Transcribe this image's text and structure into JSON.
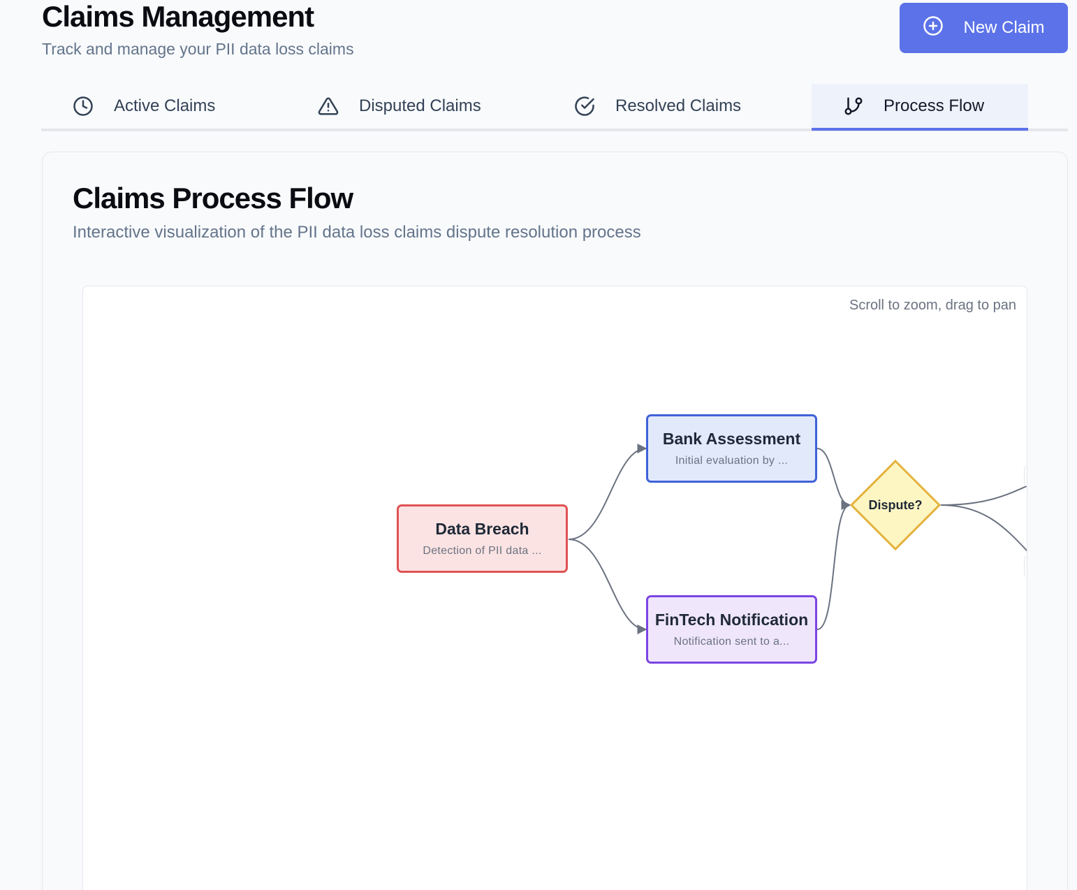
{
  "header": {
    "title": "Claims Management",
    "subtitle": "Track and manage your PII data loss claims",
    "new_claim_label": "New Claim"
  },
  "tabs": [
    {
      "label": "Active Claims",
      "icon": "clock-icon",
      "active": false
    },
    {
      "label": "Disputed Claims",
      "icon": "alert-triangle-icon",
      "active": false
    },
    {
      "label": "Resolved Claims",
      "icon": "check-circle-icon",
      "active": false
    },
    {
      "label": "Process Flow",
      "icon": "git-branch-icon",
      "active": true
    }
  ],
  "card": {
    "title": "Claims Process Flow",
    "subtitle": "Interactive visualization of the PII data loss claims dispute resolution process"
  },
  "flow": {
    "hint": "Scroll to zoom, drag to pan",
    "nodes": {
      "breach": {
        "title": "Data Breach",
        "desc": "Detection of PII data ..."
      },
      "bank": {
        "title": "Bank Assessment",
        "desc": "Initial evaluation by ..."
      },
      "fintech": {
        "title": "FinTech Notification",
        "desc": "Notification sent to a..."
      },
      "decision": {
        "label": "Dispute?"
      }
    }
  },
  "colors": {
    "accent": "#5b72e8",
    "breach_border": "#e05252",
    "bank_border": "#3f62d8",
    "fintech_border": "#7b45e3",
    "decision_border": "#e3b23c",
    "edge": "#6b7280"
  }
}
